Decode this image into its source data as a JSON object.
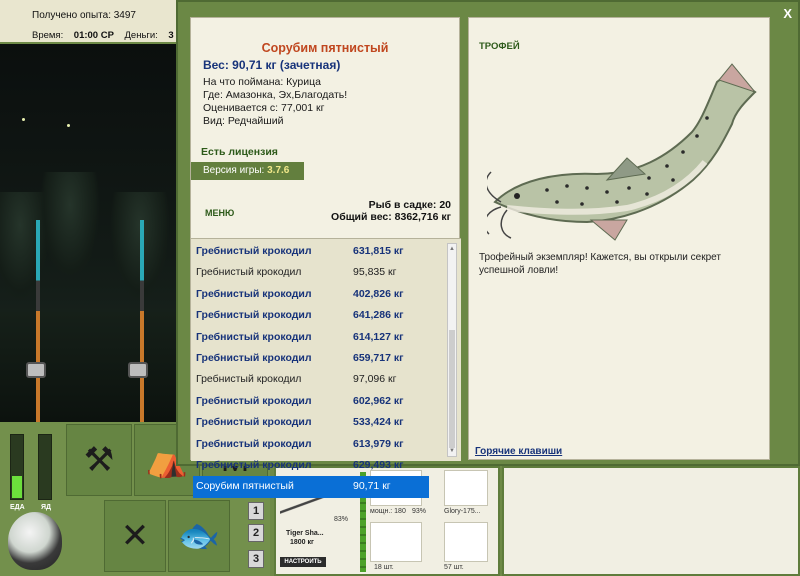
{
  "status": {
    "exp_label": "Получено опыта: 3497",
    "time_label": "Время:",
    "time_value": "01:00 СР",
    "money_label": "Деньги:",
    "money_value": "3"
  },
  "meters": {
    "food_label": "ЕДА",
    "bait_label": "ЯД",
    "food_level": 0.35,
    "bait_level": 0.0
  },
  "side_buttons": {
    "n1": "1",
    "n2": "2",
    "n3": "3"
  },
  "dialog": {
    "close_label": "X",
    "fish_name": "Сорубим пятнистый",
    "fish_weight": "Вес: 90,71 кг (зачетная)",
    "caught_on": "На что поймана: Курица",
    "location": "Где: Амазонка, Эх,Благодать!",
    "valued_from": "Оценивается с: 77,001 кг",
    "rarity": "Вид: Редчайший",
    "license": "Есть лицензия",
    "version_label": "Версия игры:",
    "version_value": "3.7.6",
    "menu": "МЕНЮ",
    "keep_count": "Рыб в садке: 20",
    "keep_weight": "Общий вес: 8362,716 кг",
    "trophy_title": "ТРОФЕЙ",
    "trophy_text": "Трофейный экземпляр! Кажется, вы открыли секрет успешной ловли!",
    "hotkeys": "Горячие клавиши"
  },
  "catch_list": [
    {
      "name": "Гребнистый крокодил",
      "weight": "631,815 кг",
      "style": "bold"
    },
    {
      "name": "Гребнистый крокодил",
      "weight": "95,835 кг",
      "style": "plain"
    },
    {
      "name": "Гребнистый крокодил",
      "weight": "402,826 кг",
      "style": "bold"
    },
    {
      "name": "Гребнистый крокодил",
      "weight": "641,286 кг",
      "style": "bold"
    },
    {
      "name": "Гребнистый крокодил",
      "weight": "614,127 кг",
      "style": "bold"
    },
    {
      "name": "Гребнистый крокодил",
      "weight": "659,717 кг",
      "style": "bold"
    },
    {
      "name": "Гребнистый крокодил",
      "weight": "97,096 кг",
      "style": "plain"
    },
    {
      "name": "Гребнистый крокодил",
      "weight": "602,962 кг",
      "style": "bold"
    },
    {
      "name": "Гребнистый крокодил",
      "weight": "533,424 кг",
      "style": "bold"
    },
    {
      "name": "Гребнистый крокодил",
      "weight": "613,979 кг",
      "style": "bold"
    },
    {
      "name": "Гребнистый крокодил",
      "weight": "629,493 кг",
      "style": "bold"
    },
    {
      "name": "Сорубим пятнистый",
      "weight": "90,71 кг",
      "style": "sel"
    }
  ],
  "inventory": {
    "rod_name": "Tiger Sha...",
    "rod_weight": "1800 кг",
    "rod_pct": "83%",
    "tune": "НАСТРОИТЬ",
    "reel_caption": "мощн.: 180",
    "reel_pct": "93%",
    "line_caption": "Glory-175...",
    "hook_caption": "18 шт.",
    "bait_caption": "57 шт."
  }
}
